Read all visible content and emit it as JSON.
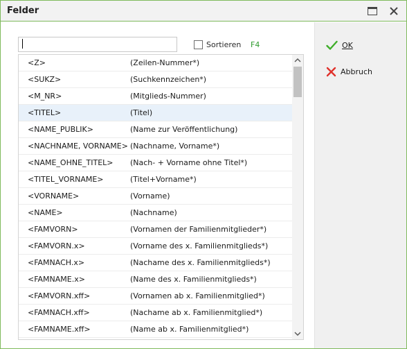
{
  "window": {
    "title": "Felder"
  },
  "search": {
    "value": "",
    "placeholder": ""
  },
  "sort": {
    "label": "Sortieren",
    "checked": false,
    "shortcut": "F4"
  },
  "fields": [
    {
      "code": "<Z>",
      "desc": "(Zeilen-Nummer*)"
    },
    {
      "code": "<SUKZ>",
      "desc": "(Suchkennzeichen*)"
    },
    {
      "code": "<M_NR>",
      "desc": "(Mitglieds-Nummer)"
    },
    {
      "code": "<TITEL>",
      "desc": "(Titel)"
    },
    {
      "code": "<NAME_PUBLIK>",
      "desc": "(Name zur Veröffentlichung)"
    },
    {
      "code": "<NACHNAME, VORNAME>",
      "desc": "(Nachname, Vorname*)"
    },
    {
      "code": "<NAME_OHNE_TITEL>",
      "desc": "(Nach- + Vorname ohne Titel*)"
    },
    {
      "code": "<TITEL_VORNAME>",
      "desc": "(Titel+Vorname*)"
    },
    {
      "code": "<VORNAME>",
      "desc": "(Vorname)"
    },
    {
      "code": "<NAME>",
      "desc": "(Nachname)"
    },
    {
      "code": "<FAMVORN>",
      "desc": "(Vornamen der Familienmitglieder*)"
    },
    {
      "code": "<FAMVORN.x>",
      "desc": "(Vorname des x. Familienmitglieds*)"
    },
    {
      "code": "<FAMNACH.x>",
      "desc": "(Nachame des x. Familienmitglieds*)"
    },
    {
      "code": "<FAMNAME.x>",
      "desc": "(Name des x. Familienmitglieds*)"
    },
    {
      "code": "<FAMVORN.xff>",
      "desc": "(Vornamen ab x. Familienmitglied*)"
    },
    {
      "code": "<FAMNACH.xff>",
      "desc": "(Nachame ab x. Familienmitglied*)"
    },
    {
      "code": "<FAMNAME.xff>",
      "desc": "(Name ab x. Familienmitglied*)"
    }
  ],
  "selected_index": 3,
  "buttons": {
    "ok": {
      "label": "OK",
      "color": "#3fae2a"
    },
    "cancel": {
      "label": "Abbruch",
      "color": "#e0312b"
    }
  },
  "colors": {
    "accent_border": "#7fba5c",
    "selection": "#e8f1fa",
    "shortcut": "#2e9b2e"
  },
  "icons": {
    "maximize": "maximize-icon",
    "close": "close-icon",
    "ok": "checkmark-icon",
    "cancel": "cross-icon",
    "scroll_up": "chevron-up-icon",
    "scroll_down": "chevron-down-icon"
  }
}
